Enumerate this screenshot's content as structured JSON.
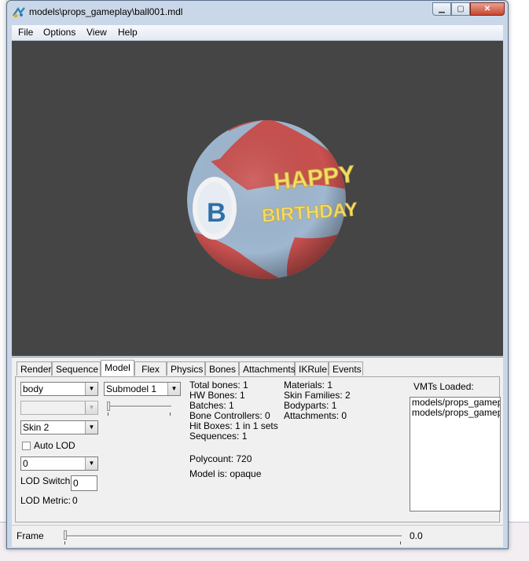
{
  "window": {
    "title": "models\\props_gameplay\\ball001.mdl"
  },
  "menu": [
    "File",
    "Options",
    "View",
    "Help"
  ],
  "viewport": {
    "ball_text_line1": "HAPPY",
    "ball_text_line2": "BIRTHDAY",
    "colors": {
      "background": "#454545",
      "red": "#c9514f",
      "blue": "#9fb7d0",
      "text": "#f3de6a"
    }
  },
  "tabs": [
    "Render",
    "Sequence",
    "Model",
    "Flex",
    "Physics",
    "Bones",
    "Attachments",
    "IKRule",
    "Events"
  ],
  "active_tab": "Model",
  "model_tab": {
    "bodypart_select": "body",
    "submodel_select": "Submodel 1",
    "skin_select": "Skin 2",
    "auto_lod_label": "Auto LOD",
    "lod_select": "0",
    "lod_switch_label": "LOD Switch:",
    "lod_switch_value": "0",
    "lod_metric_label": "LOD Metric:",
    "lod_metric_value": "0",
    "stats_col1": [
      "Total bones: 1",
      "HW Bones: 1",
      "Batches: 1",
      "Bone Controllers: 0",
      "Hit Boxes: 1 in 1 sets",
      "Sequences: 1"
    ],
    "stats_col2": [
      "Materials: 1",
      "Skin Families: 2",
      "Bodyparts: 1",
      "Attachments: 0"
    ],
    "polycount": "Polycount: 720",
    "model_is": "Model is: opaque",
    "vmts_label": "VMTs Loaded:",
    "vmts": [
      "models/props_gameplay",
      "models/props_gameplay"
    ]
  },
  "frame": {
    "label": "Frame",
    "value": "0.0"
  }
}
